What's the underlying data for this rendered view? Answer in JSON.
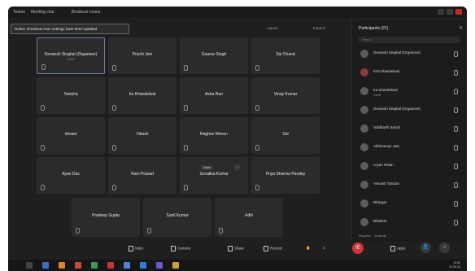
{
  "window": {
    "tabs": [
      "Teams",
      "Meeting chat",
      "Breakout rooms"
    ]
  },
  "banner": {
    "text": "Notice: Breakout room settings have been updated"
  },
  "top_controls": {
    "layout": "Layout",
    "expand": "Expand"
  },
  "tiles": [
    {
      "name": "Devansh Singhal (Organizer)",
      "sub": "Guest"
    },
    {
      "name": "Prachi Jain"
    },
    {
      "name": "Gaurav Singh"
    },
    {
      "name": "Sai Chand"
    },
    {
      "name": "Tanisha"
    },
    {
      "name": "Ira Khandelwal"
    },
    {
      "name": "Asha Rao"
    },
    {
      "name": "Vinay Kumar"
    },
    {
      "name": "Ishaan"
    },
    {
      "name": "Vikash"
    },
    {
      "name": "Raghav Menon"
    },
    {
      "name": "Sid"
    },
    {
      "name": "Ayan Das"
    },
    {
      "name": "Ram Prasad"
    },
    {
      "name": "Sonalika Kumar"
    },
    {
      "name": "Priya Sharma Pandey"
    },
    {
      "name": "Pradeep Gupta"
    },
    {
      "name": "Sunil Kumar"
    },
    {
      "name": "Aditi"
    }
  ],
  "pin_popup": "Unpin",
  "toolbar": {
    "mute": "Mute",
    "camera": "Camera",
    "share": "Share",
    "record": "Record",
    "apps": "Apps"
  },
  "panel": {
    "title": "Participants (21)",
    "search_placeholder": "Search",
    "participants": [
      {
        "name": "Devansh Singhal (Organizer)",
        "role": ""
      },
      {
        "name": "Kirti Khandelwal",
        "role": ""
      },
      {
        "name": "Ira Khandelwal",
        "role": "Guest"
      },
      {
        "name": "Devansh Singhal (Organizer)",
        "role": ""
      },
      {
        "name": "Siddharth Sarraf",
        "role": ""
      },
      {
        "name": "Abhimanyu Jain",
        "role": ""
      },
      {
        "name": "Aryan Khatri",
        "role": ""
      },
      {
        "name": "Avinash Tandon",
        "role": ""
      },
      {
        "name": "Bhargav",
        "role": ""
      },
      {
        "name": "Bhaskar",
        "role": ""
      }
    ],
    "footer": [
      "Request",
      "Invite all"
    ]
  },
  "clock": {
    "time": "10:52",
    "date": "12-04-24"
  },
  "colors": {
    "background": "#1f1f1f",
    "tile": "#2b2b2b",
    "leave": "#d13438",
    "accent": "#6e7fa0"
  }
}
